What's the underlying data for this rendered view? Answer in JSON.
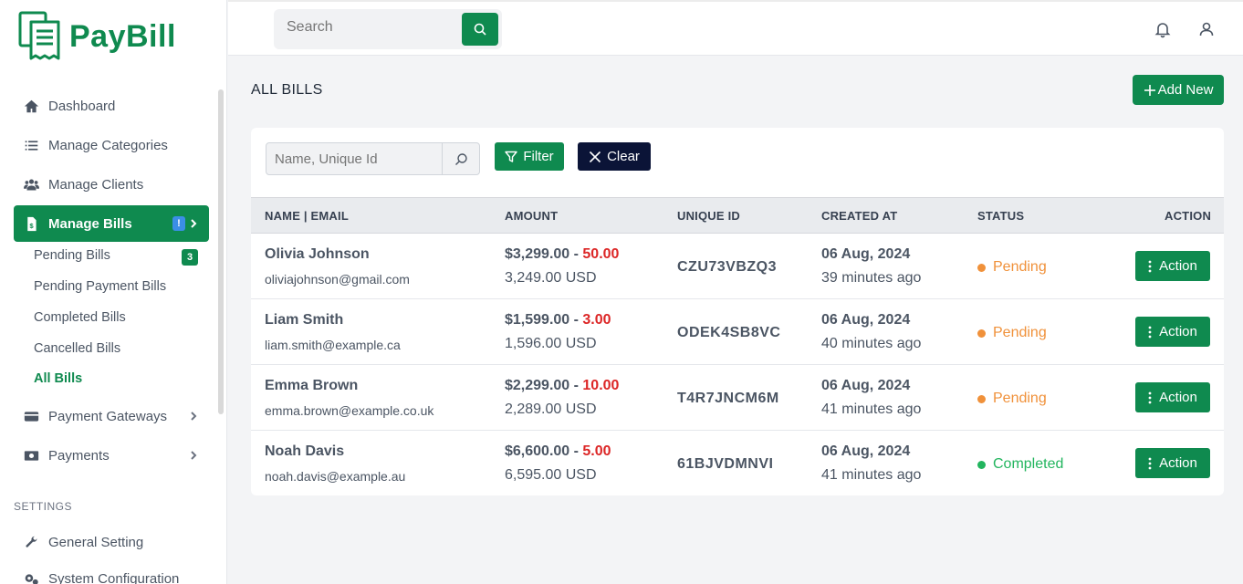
{
  "brand": {
    "name": "PayBill",
    "color": "#0f8a4f"
  },
  "search": {
    "placeholder": "Search"
  },
  "sidebar": {
    "items": [
      {
        "label": "Dashboard",
        "icon": "home-icon"
      },
      {
        "label": "Manage Categories",
        "icon": "list-icon"
      },
      {
        "label": "Manage Clients",
        "icon": "users-icon"
      },
      {
        "label": "Manage Bills",
        "icon": "bill-icon",
        "badge": "!"
      },
      {
        "label": "Payment Gateways",
        "icon": "credit-card-icon"
      },
      {
        "label": "Payments",
        "icon": "money-icon"
      }
    ],
    "subitems": [
      {
        "label": "Pending Bills",
        "count": "3"
      },
      {
        "label": "Pending Payment Bills"
      },
      {
        "label": "Completed Bills"
      },
      {
        "label": "Cancelled Bills"
      },
      {
        "label": "All Bills"
      }
    ],
    "settings_label": "SETTINGS",
    "settings": [
      {
        "label": "General Setting",
        "icon": "wrench-icon"
      },
      {
        "label": "System Configuration",
        "icon": "gears-icon"
      }
    ]
  },
  "page": {
    "title": "ALL BILLS",
    "add_button": "Add New",
    "filter_placeholder": "Name, Unique Id",
    "filter_button": "Filter",
    "clear_button": "Clear"
  },
  "table": {
    "columns": [
      "NAME | EMAIL",
      "AMOUNT",
      "UNIQUE ID",
      "CREATED AT",
      "STATUS",
      "ACTION"
    ],
    "rows": [
      {
        "name": "Olivia Johnson",
        "email": "oliviajohnson@gmail.com",
        "amount": "$3,299.00 - ",
        "fee": "50.00",
        "usd": "3,249.00 USD",
        "uid": "CZU73VBZQ3",
        "date": "06 Aug, 2024",
        "ago": "39 minutes ago",
        "status": "Pending",
        "action": "Action"
      },
      {
        "name": "Liam Smith",
        "email": "liam.smith@example.ca",
        "amount": "$1,599.00 - ",
        "fee": "3.00",
        "usd": "1,596.00 USD",
        "uid": "ODEK4SB8VC",
        "date": "06 Aug, 2024",
        "ago": "40 minutes ago",
        "status": "Pending",
        "action": "Action"
      },
      {
        "name": "Emma Brown",
        "email": "emma.brown@example.co.uk",
        "amount": "$2,299.00 - ",
        "fee": "10.00",
        "usd": "2,289.00 USD",
        "uid": "T4R7JNCM6M",
        "date": "06 Aug, 2024",
        "ago": "41 minutes ago",
        "status": "Pending",
        "action": "Action"
      },
      {
        "name": "Noah Davis",
        "email": "noah.davis@example.au",
        "amount": "$6,600.00 - ",
        "fee": "5.00",
        "usd": "6,595.00 USD",
        "uid": "61BJVDMNVI",
        "date": "06 Aug, 2024",
        "ago": "41 minutes ago",
        "status": "Completed",
        "action": "Action"
      }
    ]
  },
  "colors": {
    "pending": "#f0913a",
    "completed": "#22b55e",
    "fee": "#dc2626",
    "clear_button": "#0b1437"
  }
}
